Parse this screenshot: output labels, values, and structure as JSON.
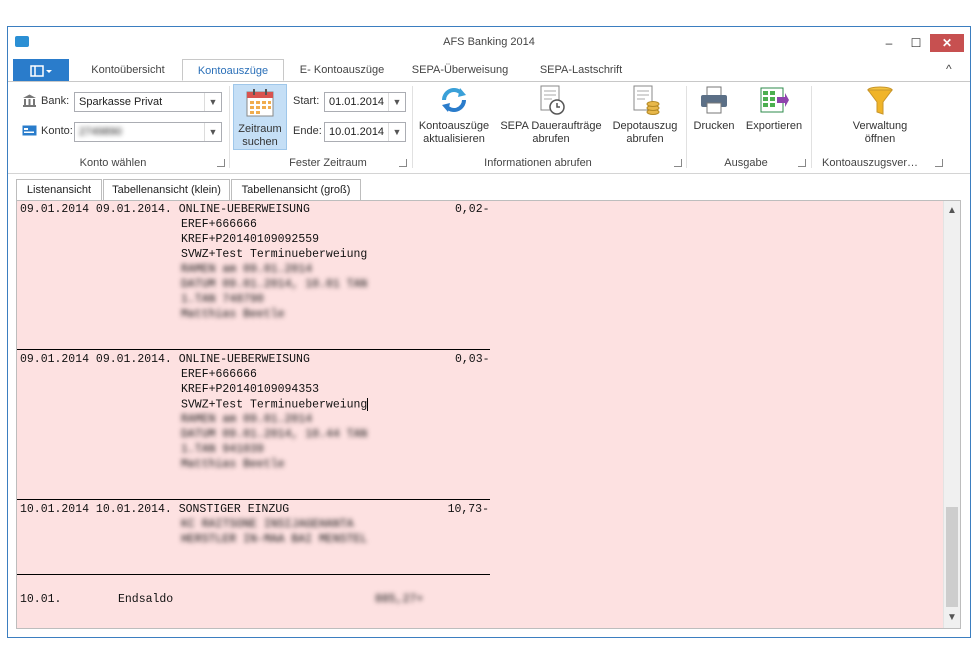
{
  "window": {
    "title": "AFS Banking 2014",
    "min": "‒",
    "max": "☐",
    "close": "✕"
  },
  "ribbon_tabs": [
    {
      "label": "Kontoübersicht"
    },
    {
      "label": "Kontoauszüge"
    },
    {
      "label": "E- Kontoauszüge"
    },
    {
      "label": "SEPA-Überweisung"
    },
    {
      "label": "SEPA-Lastschrift"
    }
  ],
  "collapse_glyph": "^",
  "konto_waehlen": {
    "bank_label": "Bank:",
    "bank_value": "Sparkasse Privat",
    "konto_label": "Konto:",
    "konto_value": "2749890",
    "group_label": "Konto wählen"
  },
  "fester_zeitraum": {
    "button_label_1": "Zeitraum",
    "button_label_2": "suchen",
    "start_label": "Start:",
    "start_value": "01.01.2014",
    "end_label": "Ende:",
    "end_value": "10.01.2014",
    "group_label": "Fester Zeitraum"
  },
  "informationen": {
    "btn1_l1": "Kontoauszüge",
    "btn1_l2": "aktualisieren",
    "btn2_l1": "SEPA Daueraufträge",
    "btn2_l2": "abrufen",
    "btn3_l1": "Depotauszug",
    "btn3_l2": "abrufen",
    "group_label": "Informationen abrufen"
  },
  "ausgabe": {
    "print": "Drucken",
    "export": "Exportieren",
    "group_label": "Ausgabe"
  },
  "verwaltung": {
    "l1": "Verwaltung",
    "l2": "öffnen",
    "group_label": "Kontoauszugsver…"
  },
  "view_tabs": [
    {
      "label": "Listenansicht"
    },
    {
      "label": "Tabellenansicht (klein)"
    },
    {
      "label": "Tabellenansicht (groß)"
    }
  ],
  "entries": [
    {
      "head": "09.01.2014 09.01.2014. ONLINE-UEBERWEISUNG",
      "amount": "0,02-",
      "lines": [
        "EREF+666666",
        "KREF+P20140109092559",
        "SVWZ+Test Terminueberweiung"
      ],
      "blurred": [
        "RAMEN am 09.01.2014",
        "DATUM 09.01.2014, 10.01 TAN",
        "1.TAN 748790",
        "Matthias Beetle"
      ]
    },
    {
      "head": "09.01.2014 09.01.2014. ONLINE-UEBERWEISUNG",
      "amount": "0,03-",
      "lines": [
        "EREF+666666",
        "KREF+P20140109094353",
        "SVWZ+Test Terminueberweiung"
      ],
      "blurred": [
        "RAMEN am 09.01.2014",
        "DATUM 09.01.2014, 10.44 TAN",
        "1.TAN 941039",
        "Matthias Beetle"
      ]
    },
    {
      "head": "10.01.2014 10.01.2014. SONSTIGER EINZUG",
      "amount": "10,73-",
      "lines": [],
      "blurred": [
        "KC RAITSONE INSIJAGEHANTA",
        "HERSTLER IN-MAA BAI MENSTEL"
      ]
    }
  ],
  "endsaldo": {
    "date": "10.01.",
    "label": "Endsaldo",
    "amount": "885,27+"
  },
  "colors": {
    "list_background": "#fde1e1",
    "accent": "#2a7ccb",
    "close": "#c75050"
  }
}
